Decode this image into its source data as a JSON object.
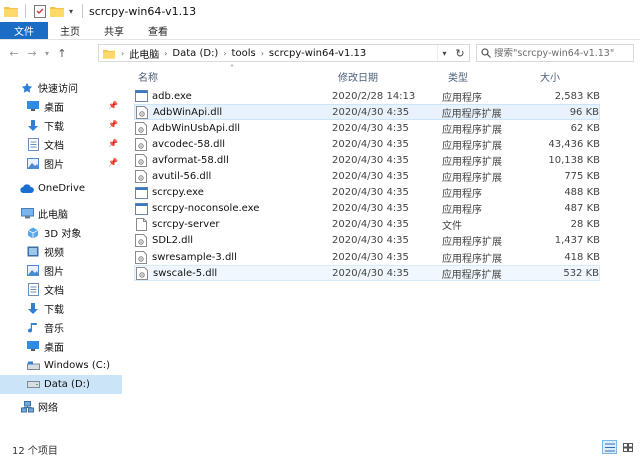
{
  "window": {
    "title": "scrcpy-win64-v1.13"
  },
  "ribbon": {
    "tabs": [
      "文件",
      "主页",
      "共享",
      "查看"
    ]
  },
  "address": {
    "crumbs": [
      "此电脑",
      "Data (D:)",
      "tools",
      "scrcpy-win64-v1.13"
    ]
  },
  "search": {
    "placeholder": "搜索\"scrcpy-win64-v1.13\""
  },
  "nav_pane": {
    "items": [
      {
        "label": "快速访问",
        "icon": "star-icon"
      },
      {
        "label": "桌面",
        "icon": "desktop-icon",
        "pinned": true
      },
      {
        "label": "下载",
        "icon": "download-icon",
        "pinned": true
      },
      {
        "label": "文档",
        "icon": "document-icon",
        "pinned": true
      },
      {
        "label": "图片",
        "icon": "picture-icon",
        "pinned": true
      },
      {
        "label": "OneDrive",
        "icon": "cloud-icon"
      },
      {
        "label": "此电脑",
        "icon": "computer-icon"
      },
      {
        "label": "3D 对象",
        "icon": "cube-icon"
      },
      {
        "label": "视频",
        "icon": "video-icon"
      },
      {
        "label": "图片",
        "icon": "picture-icon"
      },
      {
        "label": "文档",
        "icon": "document-icon"
      },
      {
        "label": "下载",
        "icon": "download-icon"
      },
      {
        "label": "音乐",
        "icon": "music-icon"
      },
      {
        "label": "桌面",
        "icon": "desktop-icon"
      },
      {
        "label": "Windows (C:)",
        "icon": "drive-icon"
      },
      {
        "label": "Data (D:)",
        "icon": "drive-icon",
        "selected": true
      },
      {
        "label": "网络",
        "icon": "network-icon"
      }
    ]
  },
  "columns": {
    "name": "名称",
    "date": "修改日期",
    "type": "类型",
    "size": "大小"
  },
  "files": [
    {
      "name": "adb.exe",
      "date": "2020/2/28 14:13",
      "type": "应用程序",
      "size": "2,583 KB",
      "icon": "exe-icon"
    },
    {
      "name": "AdbWinApi.dll",
      "date": "2020/4/30 4:35",
      "type": "应用程序扩展",
      "size": "96 KB",
      "icon": "dll-icon",
      "selected": true
    },
    {
      "name": "AdbWinUsbApi.dll",
      "date": "2020/4/30 4:35",
      "type": "应用程序扩展",
      "size": "62 KB",
      "icon": "dll-icon"
    },
    {
      "name": "avcodec-58.dll",
      "date": "2020/4/30 4:35",
      "type": "应用程序扩展",
      "size": "43,436 KB",
      "icon": "dll-icon"
    },
    {
      "name": "avformat-58.dll",
      "date": "2020/4/30 4:35",
      "type": "应用程序扩展",
      "size": "10,138 KB",
      "icon": "dll-icon"
    },
    {
      "name": "avutil-56.dll",
      "date": "2020/4/30 4:35",
      "type": "应用程序扩展",
      "size": "775 KB",
      "icon": "dll-icon"
    },
    {
      "name": "scrcpy.exe",
      "date": "2020/4/30 4:35",
      "type": "应用程序",
      "size": "488 KB",
      "icon": "exe-icon"
    },
    {
      "name": "scrcpy-noconsole.exe",
      "date": "2020/4/30 4:35",
      "type": "应用程序",
      "size": "487 KB",
      "icon": "exe-icon"
    },
    {
      "name": "scrcpy-server",
      "date": "2020/4/30 4:35",
      "type": "文件",
      "size": "28 KB",
      "icon": "file-icon"
    },
    {
      "name": "SDL2.dll",
      "date": "2020/4/30 4:35",
      "type": "应用程序扩展",
      "size": "1,437 KB",
      "icon": "dll-icon"
    },
    {
      "name": "swresample-3.dll",
      "date": "2020/4/30 4:35",
      "type": "应用程序扩展",
      "size": "418 KB",
      "icon": "dll-icon"
    },
    {
      "name": "swscale-5.dll",
      "date": "2020/4/30 4:35",
      "type": "应用程序扩展",
      "size": "532 KB",
      "icon": "dll-icon",
      "hover": true
    }
  ],
  "status": {
    "count": "12 个项目"
  },
  "colors": {
    "accent": "#1a6cc4",
    "selection": "#cce4f7",
    "header_text": "#4c607a"
  }
}
